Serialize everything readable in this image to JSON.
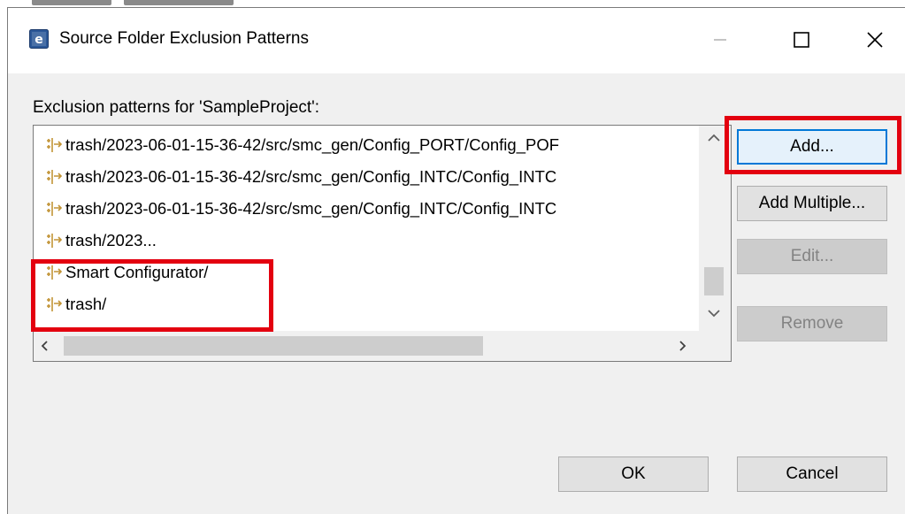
{
  "window": {
    "title": "Source Folder Exclusion Patterns",
    "controls": {
      "minimize": "—",
      "maximize": "☐",
      "close": "✕"
    }
  },
  "dialog": {
    "label": "Exclusion patterns for 'SampleProject':",
    "patterns": [
      "trash/2023-06-01-15-36-42/src/smc_gen/Config_PORT/Config_POF",
      "trash/2023-06-01-15-36-42/src/smc_gen/Config_INTC/Config_INTC",
      "trash/2023-06-01-15-36-42/src/smc_gen/Config_INTC/Config_INTC",
      "trash/2023...",
      "Smart Configurator/",
      "trash/"
    ],
    "buttons": {
      "add": "Add...",
      "add_multiple": "Add Multiple...",
      "edit": "Edit...",
      "remove": "Remove",
      "ok": "OK",
      "cancel": "Cancel"
    }
  },
  "colors": {
    "highlight": "#e3000f",
    "default_button_border": "#0078d7",
    "dialog_background": "#f0f0f0",
    "disabled_text": "#838383"
  },
  "icons": {
    "app": "eclipse-app-icon",
    "pattern": "exclusion-pattern-icon"
  }
}
